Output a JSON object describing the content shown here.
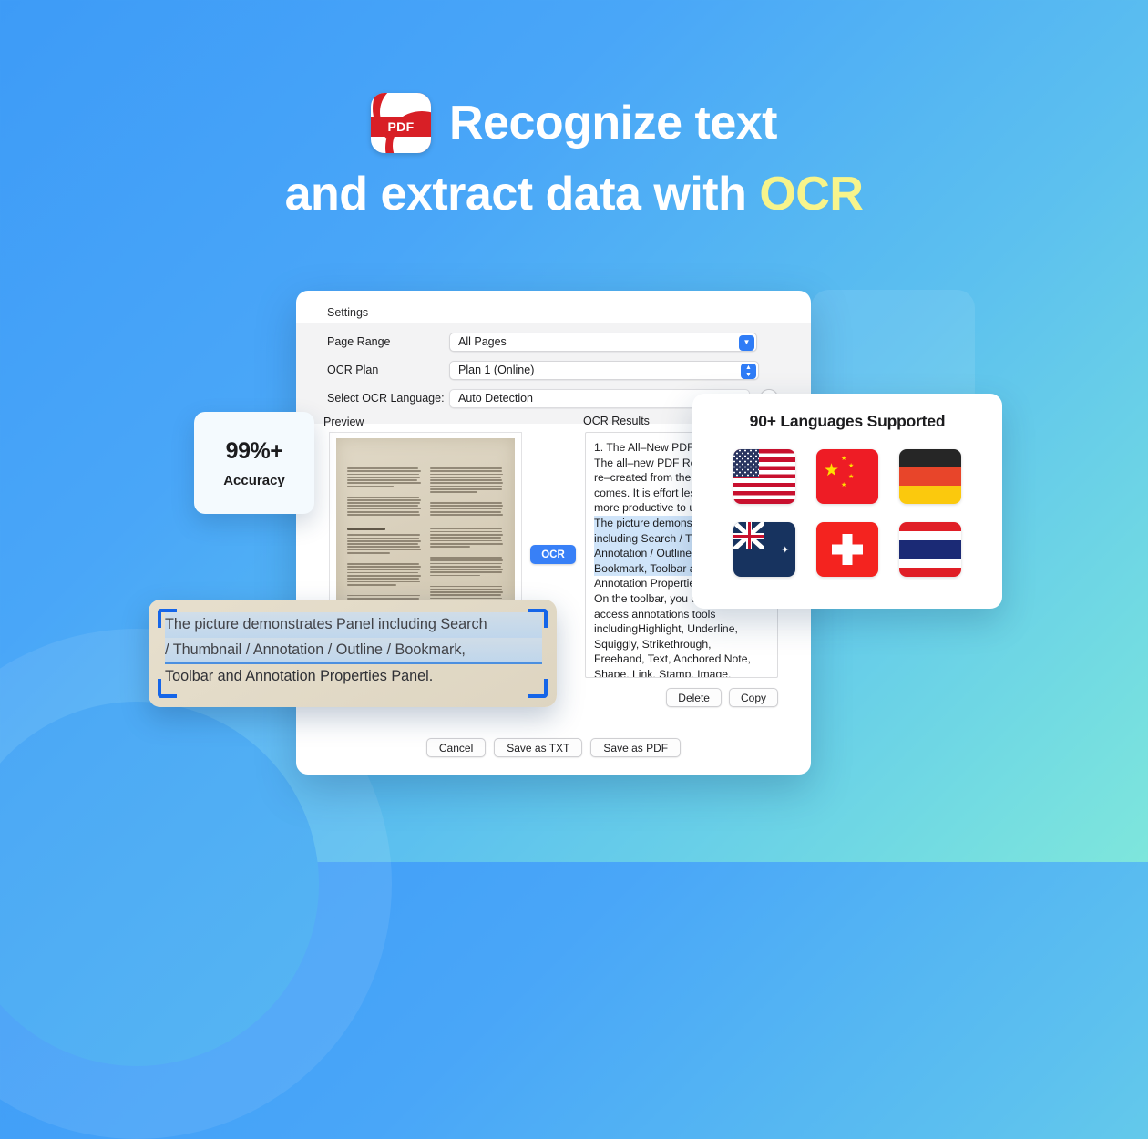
{
  "theme": {
    "bg_start": "#3d9bf7",
    "bg_end": "#7ee6dc",
    "accent_blue": "#3880f7",
    "accent_yellow": "#f7f48b",
    "highlight_blue": "#cfe4f9"
  },
  "headline": {
    "app_icon_label": "PDF",
    "line1": "Recognize text",
    "line2_prefix": "and extract data with ",
    "line2_accent": "OCR"
  },
  "dialog": {
    "settings_title": "Settings",
    "rows": [
      {
        "label": "Page Range",
        "value": "All Pages",
        "control": "popup-button"
      },
      {
        "label": "OCR Plan",
        "value": "Plan 1 (Online)",
        "control": "stepper-select"
      },
      {
        "label": "Select OCR Language:",
        "value": "Auto Detection",
        "control": "combo-box",
        "help": "?"
      }
    ],
    "preview_label": "Preview",
    "results_label": "OCR Results",
    "ocr_button": "OCR",
    "results_lines": [
      {
        "text": "1. The All–New PDF R",
        "highlighted": false
      },
      {
        "text": "The all–new PDF Rea",
        "highlighted": false
      },
      {
        "text": "re–created from the",
        "highlighted": false
      },
      {
        "text": "comes. It is effort les",
        "highlighted": false
      },
      {
        "text": "more productive to u",
        "highlighted": false
      },
      {
        "text": "The picture demonst",
        "highlighted": true
      },
      {
        "text": "including Search / Th",
        "highlighted": true
      },
      {
        "text": "Annotation / Outline",
        "highlighted": true
      },
      {
        "text": "Bookmark,  Toolbar a",
        "highlighted": true
      },
      {
        "text": "Annotation Propertie",
        "highlighted": false
      },
      {
        "text": "On the toolbar, you c",
        "highlighted": false
      },
      {
        "text": "access annotations tools",
        "highlighted": false
      },
      {
        "text": "includingHighlight, Underline,",
        "highlighted": false
      },
      {
        "text": "Squiggly, Strikethrough,",
        "highlighted": false
      },
      {
        "text": "Freehand, Text, Anchored Note,",
        "highlighted": false
      },
      {
        "text": "Shape, Link, Stamp, Image,",
        "highlighted": false
      }
    ],
    "results_actions": [
      "Delete",
      "Copy"
    ],
    "footer_actions": [
      "Cancel",
      "Save as TXT",
      "Save as PDF"
    ]
  },
  "accuracy_card": {
    "value": "99%+",
    "label": "Accuracy"
  },
  "languages_card": {
    "title": "90+ Languages Supported",
    "flags": [
      {
        "name": "united-states",
        "code": "US"
      },
      {
        "name": "china",
        "code": "CN"
      },
      {
        "name": "germany",
        "code": "DE"
      },
      {
        "name": "australia",
        "code": "AU"
      },
      {
        "name": "switzerland",
        "code": "CH"
      },
      {
        "name": "thailand",
        "code": "TH"
      }
    ]
  },
  "magnified_overlay": {
    "line1": "The picture demonstrates Panel including Search",
    "line2": "/ Thumbnail / Annotation / Outline / Bookmark,",
    "line3": "Toolbar and Annotation Properties Panel.",
    "scan_corners": 4
  }
}
